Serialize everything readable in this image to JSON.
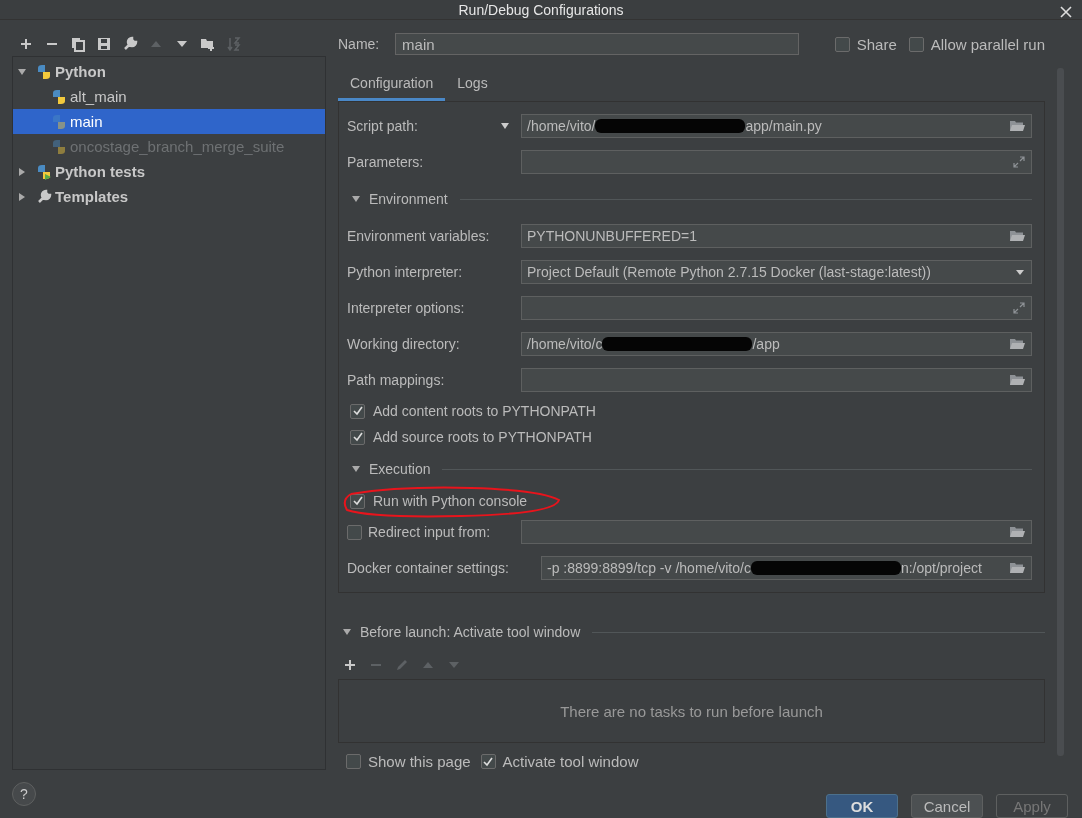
{
  "window": {
    "title": "Run/Debug Configurations"
  },
  "toolbar": [
    {
      "kind": "add",
      "disabled": false
    },
    {
      "kind": "remove",
      "disabled": false
    },
    {
      "kind": "copy",
      "disabled": false
    },
    {
      "kind": "save",
      "disabled": false
    },
    {
      "kind": "wrench",
      "disabled": false
    },
    {
      "kind": "up",
      "disabled": true
    },
    {
      "kind": "down",
      "disabled": false
    },
    {
      "kind": "folder",
      "disabled": false
    },
    {
      "kind": "sort",
      "disabled": true
    }
  ],
  "tree": [
    {
      "label": "Python",
      "kind": "python",
      "expanded": true,
      "selected": false,
      "children": [
        {
          "label": "alt_main",
          "selected": false,
          "dimmed": false
        },
        {
          "label": "main",
          "selected": true,
          "dimmed": false
        },
        {
          "label": "oncostage_branch_merge_suite",
          "selected": false,
          "dimmed": true
        }
      ]
    },
    {
      "label": "Python tests",
      "kind": "tests",
      "expanded": false,
      "selected": false
    },
    {
      "label": "Templates",
      "kind": "templates",
      "expanded": false,
      "selected": false
    }
  ],
  "name_field": {
    "label": "Name:",
    "value": "main"
  },
  "header_options": [
    {
      "label": "Share",
      "checked": false
    },
    {
      "label": "Allow parallel run",
      "checked": false
    }
  ],
  "tabs": [
    {
      "label": "Configuration",
      "selected": true
    },
    {
      "label": "Logs",
      "selected": false
    }
  ],
  "form": [
    {
      "kind": "path",
      "label": "Script path:",
      "label_dropdown": true,
      "value": "/home/vito/",
      "redacted": true,
      "value_after": "app/main.py"
    },
    {
      "kind": "text",
      "label": "Parameters:"
    },
    {
      "kind": "section",
      "label": "Environment"
    },
    {
      "kind": "path",
      "label": "Environment variables:",
      "value": "PYTHONUNBUFFERED=1"
    },
    {
      "kind": "combo",
      "label": "Python interpreter:",
      "value": "Project Default (Remote Python 2.7.15 Docker (last-stage:latest))"
    },
    {
      "kind": "text",
      "label": "Interpreter options:"
    },
    {
      "kind": "path",
      "label": "Working directory:",
      "value": "/home/vito/c",
      "redacted": true,
      "value_after": "/app"
    },
    {
      "kind": "path",
      "label": "Path mappings:"
    },
    {
      "kind": "checkbox",
      "label": "Add content roots to PYTHONPATH",
      "checked": true
    },
    {
      "kind": "checkbox",
      "label": "Add source roots to PYTHONPATH",
      "checked": true
    },
    {
      "kind": "section",
      "label": "Execution"
    },
    {
      "kind": "checkbox",
      "label": "Run with Python console",
      "checked": true,
      "highlighted": true
    },
    {
      "kind": "checkbox-path",
      "label": "Redirect input from:",
      "checked": false
    },
    {
      "kind": "path",
      "label": "Docker container settings:",
      "value": "-p :8899:8899/tcp -v /home/vito/c",
      "redacted": true,
      "value_after": "n:/opt/project"
    }
  ],
  "before_launch": {
    "title": "Before launch: Activate tool window",
    "expanded": true,
    "toolbar": [
      {
        "kind": "add",
        "disabled": false
      },
      {
        "kind": "remove",
        "disabled": true
      },
      {
        "kind": "edit",
        "disabled": true
      },
      {
        "kind": "up",
        "disabled": true
      },
      {
        "kind": "down",
        "disabled": true
      }
    ],
    "empty_text": "There are no tasks to run before launch",
    "options": [
      {
        "label": "Show this page",
        "checked": false
      },
      {
        "label": "Activate tool window",
        "checked": true
      }
    ]
  },
  "help": "?",
  "buttons": [
    {
      "label": "OK",
      "kind": "primary"
    },
    {
      "label": "Cancel",
      "kind": "normal"
    },
    {
      "label": "Apply",
      "kind": "disabled"
    }
  ]
}
